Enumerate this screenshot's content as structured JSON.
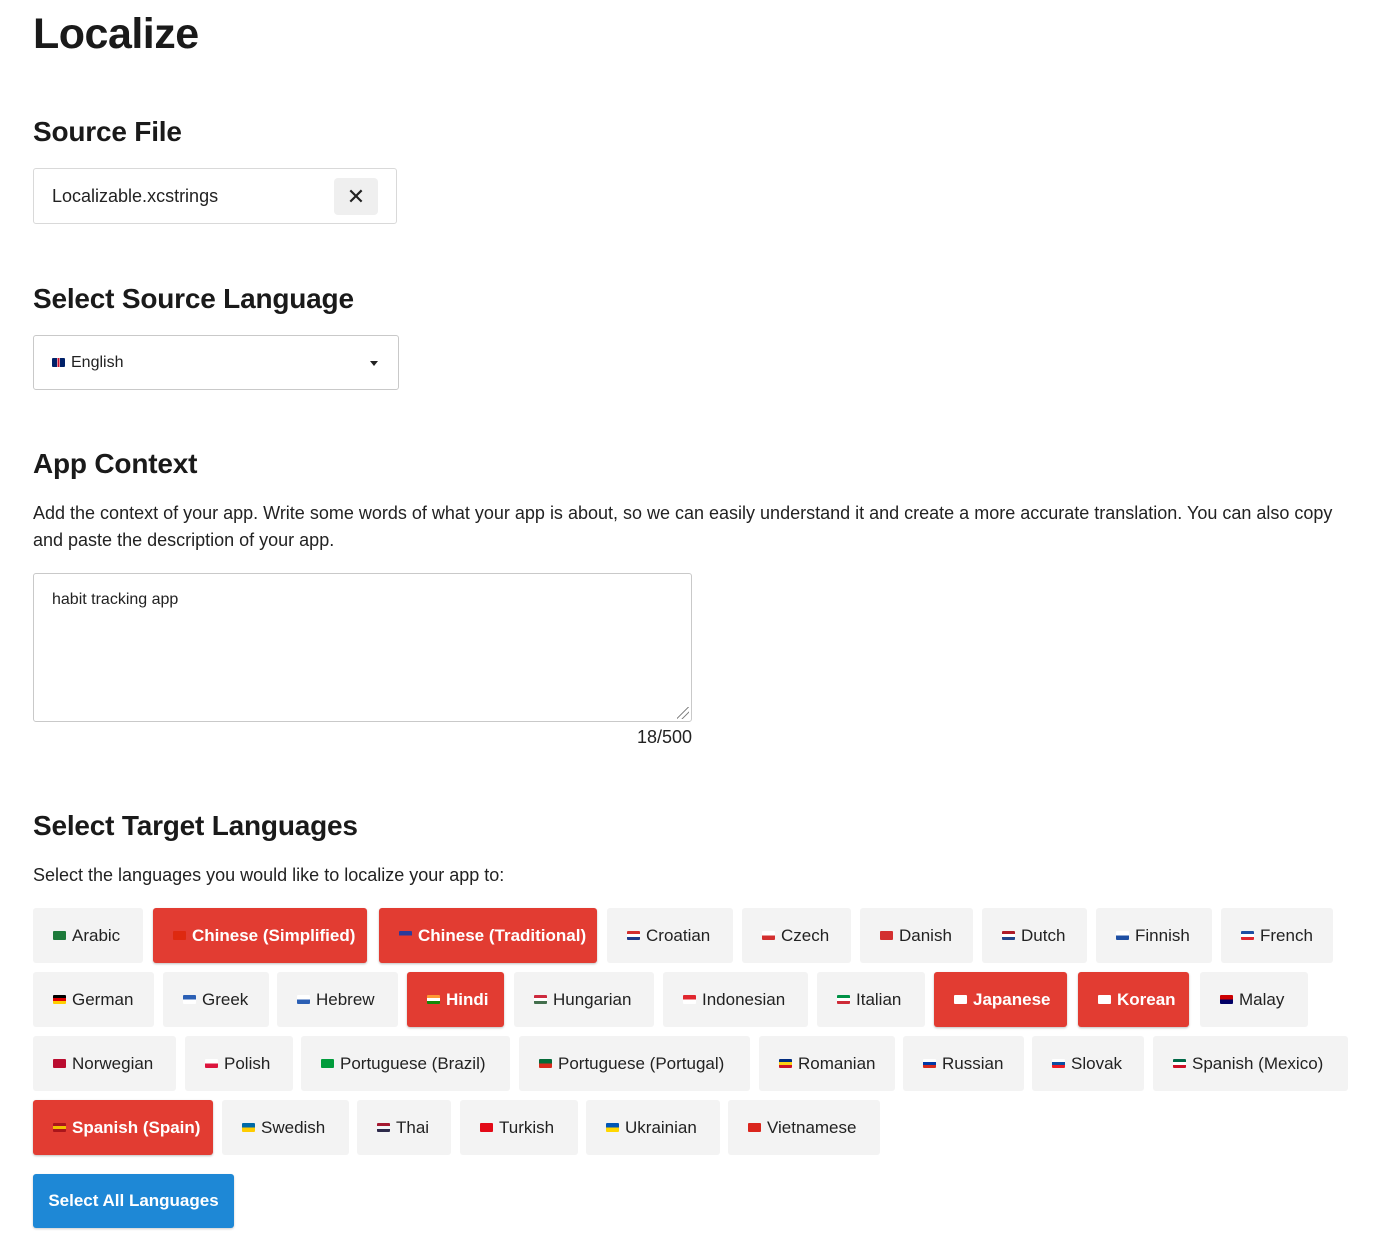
{
  "page_title": "Localize",
  "source_file": {
    "heading": "Source File",
    "file_name": "Localizable.xcstrings",
    "clear_icon": "close-icon",
    "clear_glyph": "✕"
  },
  "source_language": {
    "heading": "Select Source Language",
    "selected": "English",
    "flag_icon": "uk-flag-icon"
  },
  "app_context": {
    "heading": "App Context",
    "description": "Add the context of your app. Write some words of what your app is about, so we can easily understand it and create a more accurate translation. You can also copy and paste the description of your app.",
    "value": "habit tracking app",
    "counter": "18/500"
  },
  "target_languages": {
    "heading": "Select Target Languages",
    "description": "Select the languages you would like to localize your app to:",
    "rows": [
      [
        {
          "label": "Arabic",
          "selected": false,
          "flag": [
            "#1d7a3a"
          ]
        },
        {
          "label": "Chinese (Simplified)",
          "selected": true,
          "flag": [
            "#de2910"
          ]
        },
        {
          "label": "Chinese (Traditional)",
          "selected": true,
          "flag": [
            "#2b3a9a",
            "#e83a2e"
          ]
        },
        {
          "label": "Croatian",
          "selected": false,
          "flag": [
            "#d32f2f",
            "#ffffff",
            "#1e3a8a"
          ]
        },
        {
          "label": "Czech",
          "selected": false,
          "flag": [
            "#ffffff",
            "#d32f2f"
          ]
        },
        {
          "label": "Danish",
          "selected": false,
          "flag": [
            "#d32f2f"
          ]
        },
        {
          "label": "Dutch",
          "selected": false,
          "flag": [
            "#ae1c28",
            "#ffffff",
            "#21468b"
          ]
        },
        {
          "label": "Finnish",
          "selected": false,
          "flag": [
            "#ffffff",
            "#1e4fa3"
          ]
        },
        {
          "label": "French",
          "selected": false,
          "flag": [
            "#1e4fa3",
            "#ffffff",
            "#e0262e"
          ]
        }
      ],
      [
        {
          "label": "German",
          "selected": false,
          "flag": [
            "#000000",
            "#dd0000",
            "#ffce00"
          ]
        },
        {
          "label": "Greek",
          "selected": false,
          "flag": [
            "#2b5fb4",
            "#ffffff"
          ]
        },
        {
          "label": "Hebrew",
          "selected": false,
          "flag": [
            "#ffffff",
            "#2b5fb4"
          ]
        },
        {
          "label": "Hindi",
          "selected": true,
          "flag": [
            "#ff9933",
            "#ffffff",
            "#138808"
          ]
        },
        {
          "label": "Hungarian",
          "selected": false,
          "flag": [
            "#cd2a3e",
            "#ffffff",
            "#436f4d"
          ]
        },
        {
          "label": "Indonesian",
          "selected": false,
          "flag": [
            "#e0262e",
            "#ffffff"
          ]
        },
        {
          "label": "Italian",
          "selected": false,
          "flag": [
            "#009246",
            "#ffffff",
            "#ce2b37"
          ]
        },
        {
          "label": "Japanese",
          "selected": true,
          "flag": [
            "#ffffff"
          ]
        },
        {
          "label": "Korean",
          "selected": true,
          "flag": [
            "#ffffff"
          ]
        },
        {
          "label": "Malay",
          "selected": false,
          "flag": [
            "#cc0001",
            "#010066"
          ]
        }
      ],
      [
        {
          "label": "Norwegian",
          "selected": false,
          "flag": [
            "#ba0c2f"
          ]
        },
        {
          "label": "Polish",
          "selected": false,
          "flag": [
            "#ffffff",
            "#dc143c"
          ]
        },
        {
          "label": "Portuguese (Brazil)",
          "selected": false,
          "flag": [
            "#009c3b"
          ]
        },
        {
          "label": "Portuguese (Portugal)",
          "selected": false,
          "flag": [
            "#046a38",
            "#da291c"
          ]
        },
        {
          "label": "Romanian",
          "selected": false,
          "flag": [
            "#002b7f",
            "#fcd116",
            "#ce1126"
          ]
        },
        {
          "label": "Russian",
          "selected": false,
          "flag": [
            "#ffffff",
            "#0039a6",
            "#d52b1e"
          ]
        },
        {
          "label": "Slovak",
          "selected": false,
          "flag": [
            "#ffffff",
            "#0b4ea2",
            "#ee1c25"
          ]
        },
        {
          "label": "Spanish (Mexico)",
          "selected": false,
          "flag": [
            "#006847",
            "#ffffff",
            "#ce1126"
          ]
        }
      ],
      [
        {
          "label": "Spanish (Spain)",
          "selected": true,
          "flag": [
            "#aa151b",
            "#f1bf00",
            "#aa151b"
          ]
        },
        {
          "label": "Swedish",
          "selected": false,
          "flag": [
            "#006aa7",
            "#fecc00"
          ]
        },
        {
          "label": "Thai",
          "selected": false,
          "flag": [
            "#a51931",
            "#f4f5f8",
            "#2d2a4a"
          ]
        },
        {
          "label": "Turkish",
          "selected": false,
          "flag": [
            "#e30a17"
          ]
        },
        {
          "label": "Ukrainian",
          "selected": false,
          "flag": [
            "#0057b7",
            "#ffd700"
          ]
        },
        {
          "label": "Vietnamese",
          "selected": false,
          "flag": [
            "#da251d"
          ]
        }
      ]
    ],
    "select_all_label": "Select All Languages"
  }
}
